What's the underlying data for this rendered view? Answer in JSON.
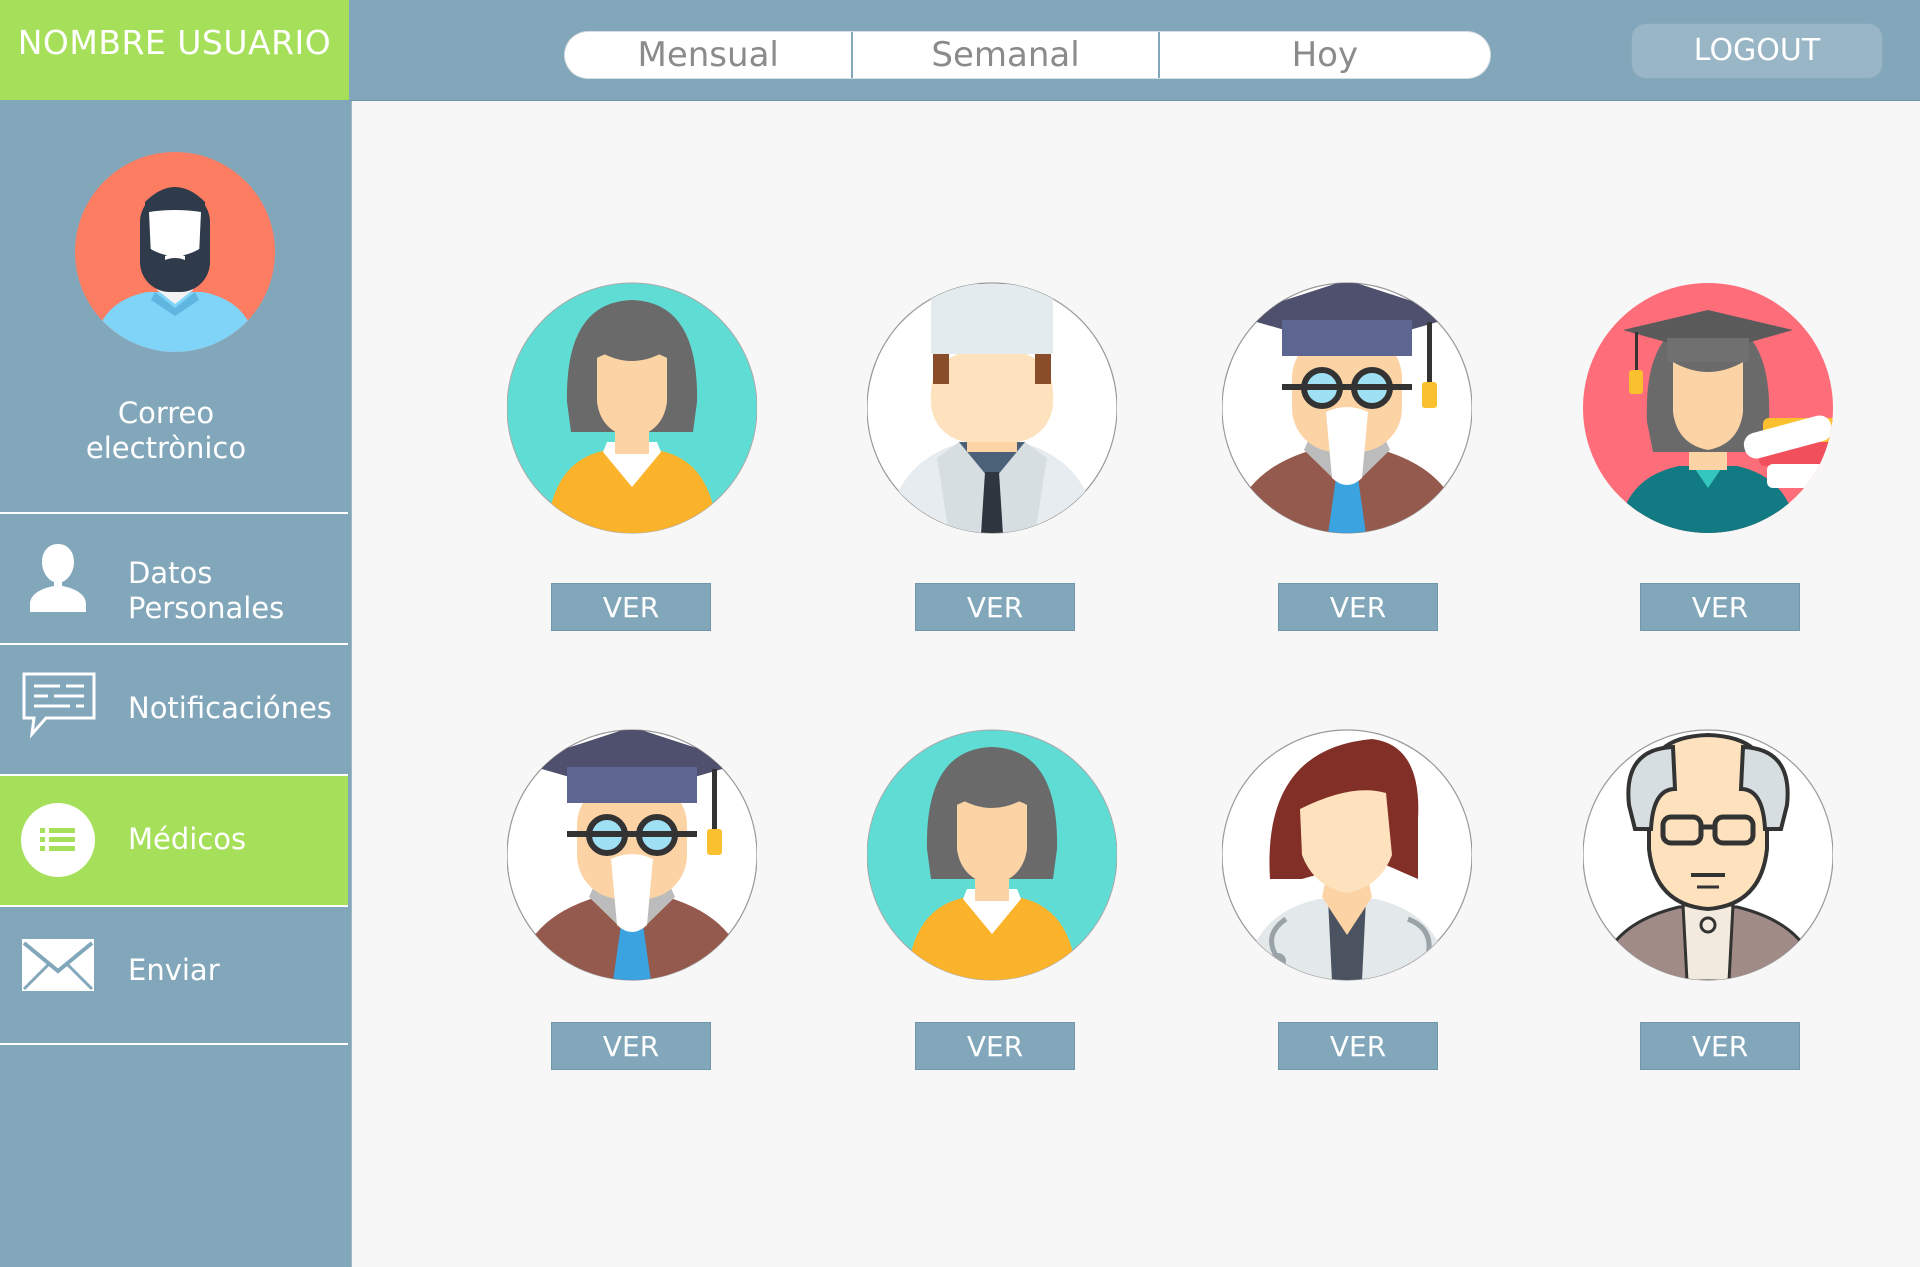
{
  "header": {
    "brand": "NOMBRE USUARIO",
    "tabs": [
      {
        "label": "Mensual"
      },
      {
        "label": "Semanal"
      },
      {
        "label": "Hoy"
      }
    ],
    "logout_label": "LOGOUT"
  },
  "profile": {
    "email_label_line1": "Correo",
    "email_label_line2": "electrònico"
  },
  "nav": {
    "items": [
      {
        "label_line1": "Datos",
        "label_line2": "Personales",
        "icon": "user-silhouette-icon"
      },
      {
        "label": "Notificaciónes",
        "icon": "chat-bubble-icon"
      },
      {
        "label": "Médicos",
        "icon": "list-icon",
        "active": true
      },
      {
        "label": "Enviar",
        "icon": "envelope-icon"
      }
    ]
  },
  "doctors": [
    {
      "avatar": "woman-doctor-avatar",
      "button": "VER"
    },
    {
      "avatar": "chef-hat-doctor-avatar",
      "button": "VER"
    },
    {
      "avatar": "professor-avatar",
      "button": "VER"
    },
    {
      "avatar": "graduate-woman-avatar",
      "button": "VER"
    },
    {
      "avatar": "professor-avatar",
      "button": "VER"
    },
    {
      "avatar": "woman-doctor-avatar",
      "button": "VER"
    },
    {
      "avatar": "red-hair-doctor-avatar",
      "button": "VER"
    },
    {
      "avatar": "old-man-avatar",
      "button": "VER"
    }
  ],
  "colors": {
    "accent": "#a6e05a",
    "panel": "#82a7ba",
    "background": "#f7f7f8"
  }
}
